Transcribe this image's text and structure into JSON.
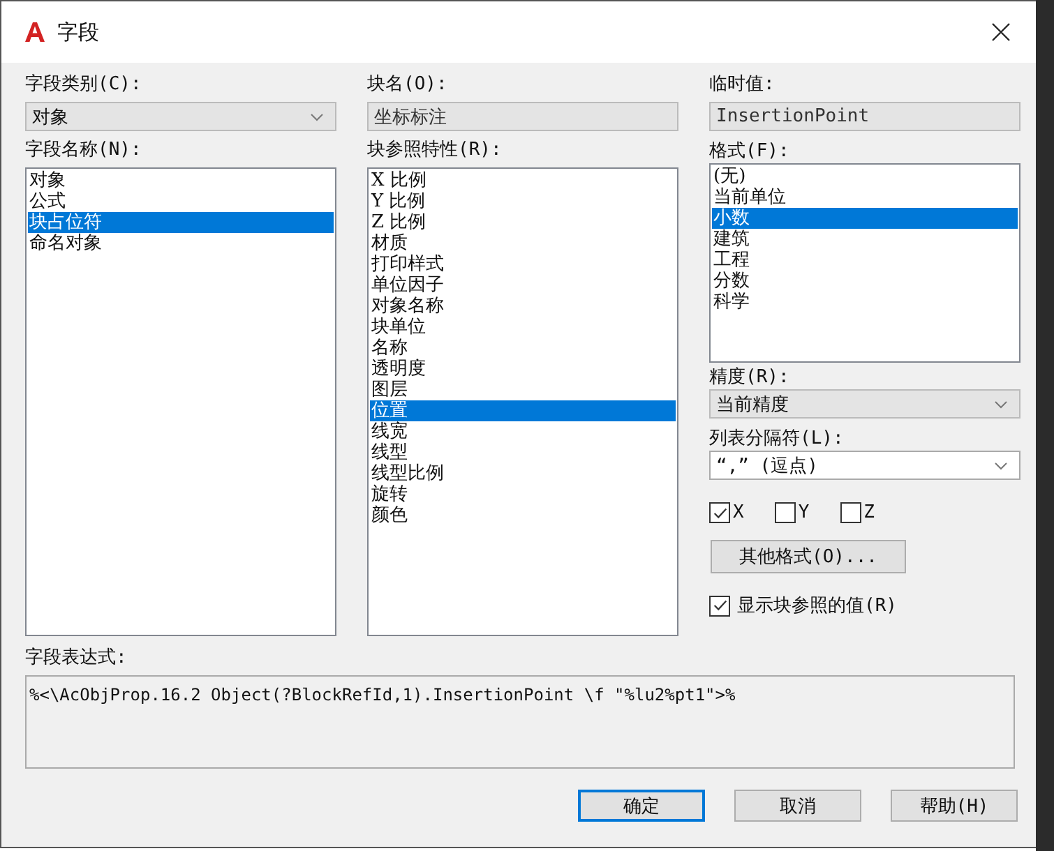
{
  "window": {
    "title": "字段"
  },
  "field_category": {
    "label": "字段类别(C):",
    "value": "对象"
  },
  "field_names": {
    "label": "字段名称(N):",
    "items": [
      {
        "text": "对象",
        "selected": false
      },
      {
        "text": "公式",
        "selected": false
      },
      {
        "text": "块占位符",
        "selected": true
      },
      {
        "text": "命名对象",
        "selected": false
      }
    ]
  },
  "block_name": {
    "label": "块名(O):",
    "value": "坐标标注"
  },
  "block_properties": {
    "label": "块参照特性(R):",
    "items": [
      {
        "text": "X 比例",
        "selected": false
      },
      {
        "text": "Y 比例",
        "selected": false
      },
      {
        "text": "Z 比例",
        "selected": false
      },
      {
        "text": "材质",
        "selected": false
      },
      {
        "text": "打印样式",
        "selected": false
      },
      {
        "text": "单位因子",
        "selected": false
      },
      {
        "text": "对象名称",
        "selected": false
      },
      {
        "text": "块单位",
        "selected": false
      },
      {
        "text": "名称",
        "selected": false
      },
      {
        "text": "透明度",
        "selected": false
      },
      {
        "text": "图层",
        "selected": false
      },
      {
        "text": "位置",
        "selected": true
      },
      {
        "text": "线宽",
        "selected": false
      },
      {
        "text": "线型",
        "selected": false
      },
      {
        "text": "线型比例",
        "selected": false
      },
      {
        "text": "旋转",
        "selected": false
      },
      {
        "text": "颜色",
        "selected": false
      }
    ]
  },
  "preview_value": {
    "label": "临时值:",
    "value": "InsertionPoint"
  },
  "format": {
    "label": "格式(F):",
    "items": [
      {
        "text": "(无)",
        "selected": false
      },
      {
        "text": "当前单位",
        "selected": false
      },
      {
        "text": "小数",
        "selected": true
      },
      {
        "text": "建筑",
        "selected": false
      },
      {
        "text": "工程",
        "selected": false
      },
      {
        "text": "分数",
        "selected": false
      },
      {
        "text": "科学",
        "selected": false
      }
    ]
  },
  "precision": {
    "label": "精度(R):",
    "value": "当前精度"
  },
  "list_separator": {
    "label": "列表分隔符(L):",
    "value": "“,” (逗点)"
  },
  "axes": [
    {
      "label": "X",
      "checked": true
    },
    {
      "label": "Y",
      "checked": false
    },
    {
      "label": "Z",
      "checked": false
    }
  ],
  "other_format_button": "其他格式(O)...",
  "show_block_value": {
    "label": "显示块参照的值(R)",
    "checked": true
  },
  "expression": {
    "label": "字段表达式:",
    "value": "%<\\AcObjProp.16.2 Object(?BlockRefId,1).InsertionPoint \\f \"%lu2%pt1\">%"
  },
  "buttons": [
    {
      "label": "确定",
      "kind": "default"
    },
    {
      "label": "取消",
      "kind": "normal"
    },
    {
      "label": "帮助(H)",
      "kind": "normal"
    }
  ]
}
